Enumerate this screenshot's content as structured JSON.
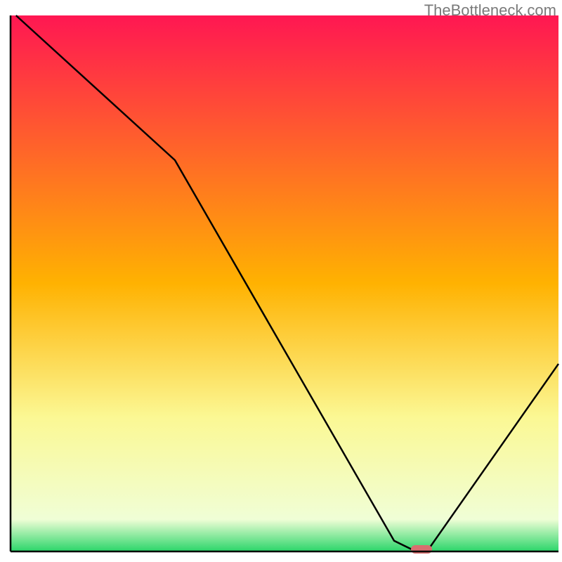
{
  "watermark": "TheBottleneck.com",
  "chart_data": {
    "type": "line",
    "title": "",
    "xlabel": "",
    "ylabel": "",
    "xlim": [
      0,
      100
    ],
    "ylim": [
      0,
      100
    ],
    "x": [
      1,
      30,
      70,
      74,
      76,
      100
    ],
    "values": [
      100,
      73,
      2,
      0,
      0,
      35
    ],
    "marker": {
      "x": 75,
      "y": 0,
      "color": "#d96e6f"
    },
    "gradient_stops": [
      {
        "offset": 0,
        "color": "#ff1752"
      },
      {
        "offset": 50,
        "color": "#ffb201"
      },
      {
        "offset": 75,
        "color": "#fbf894"
      },
      {
        "offset": 94,
        "color": "#f0fed6"
      },
      {
        "offset": 100,
        "color": "#2ad569"
      }
    ],
    "axis_color": "#000000",
    "line_color": "#000000"
  }
}
